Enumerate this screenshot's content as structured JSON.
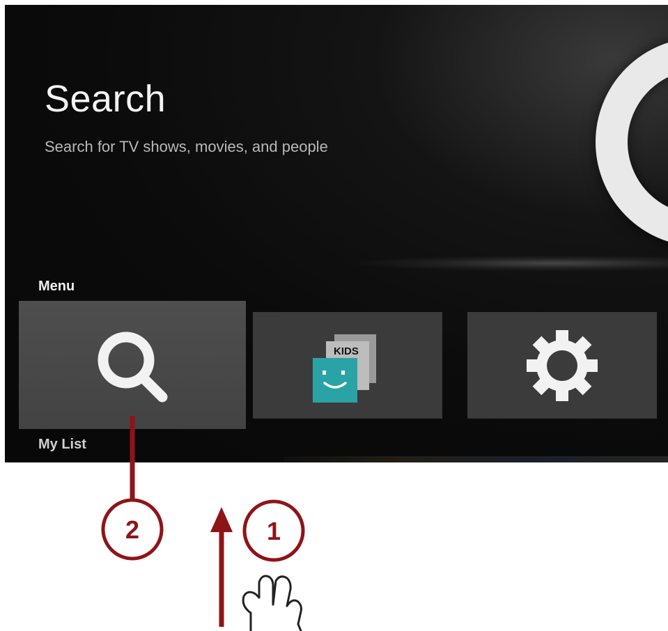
{
  "header": {
    "title": "Search",
    "subtitle": "Search for TV shows, movies, and people"
  },
  "menu": {
    "label": "Menu",
    "items": [
      {
        "name": "Search",
        "icon": "search-icon",
        "selected": true
      },
      {
        "name": "Kids",
        "icon": "kids-icon",
        "badge_text": "KIDS",
        "selected": false
      },
      {
        "name": "Settings",
        "icon": "gear-icon",
        "selected": false
      }
    ]
  },
  "my_list": {
    "label": "My List"
  },
  "callouts": [
    {
      "number": "2"
    },
    {
      "number": "1"
    }
  ],
  "colors": {
    "background": "#0b0b0b",
    "tile": "#3b3b3b",
    "tile_selected": "#4a4a4a",
    "kids_teal": "#2aa3a6",
    "callout_red": "#8e1418"
  }
}
